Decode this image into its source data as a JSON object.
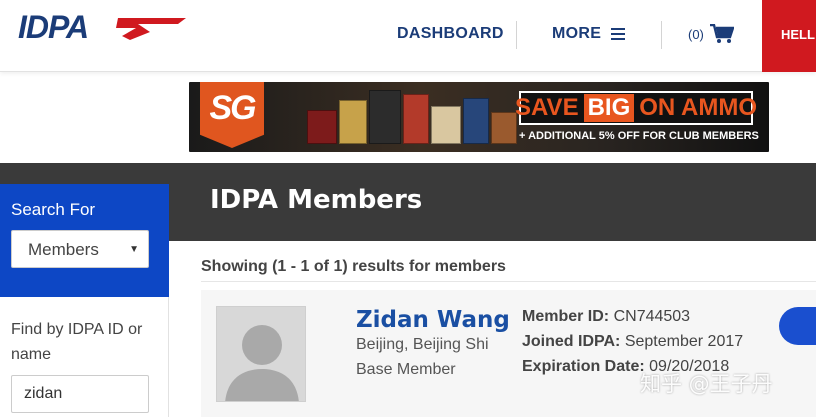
{
  "header": {
    "logo_alt": "IDPA",
    "nav": {
      "dashboard": "DASHBOARD",
      "more": "MORE"
    },
    "cart_count": "(0)",
    "hello": "HELL",
    "brand_color": "#1b3c78",
    "accent_color": "#d0191f"
  },
  "banner": {
    "badge": "SG",
    "headline_part1": "SAVE",
    "headline_part2": "BIG",
    "headline_part3": "ON AMMO",
    "subline": "+ ADDITIONAL 5% OFF FOR CLUB MEMBERS",
    "accent_color": "#e8561f"
  },
  "sidebar": {
    "search_for_label": "Search For",
    "search_for_value": "Members",
    "find_label": "Find by IDPA ID or name",
    "find_value": "zidan",
    "panel_color": "#0d47c5"
  },
  "main": {
    "title": "IDPA Members",
    "results_text": "Showing (1 - 1 of 1) results for members",
    "member": {
      "name": "Zidan Wang",
      "location": "Beijing, Beijing Shi",
      "type": "Base Member",
      "member_id_label": "Member ID:",
      "member_id": "CN744503",
      "joined_label": "Joined IDPA:",
      "joined": "September 2017",
      "expiration_label": "Expiration Date:",
      "expiration": "09/20/2018"
    }
  },
  "watermark": "知乎 @王子丹"
}
